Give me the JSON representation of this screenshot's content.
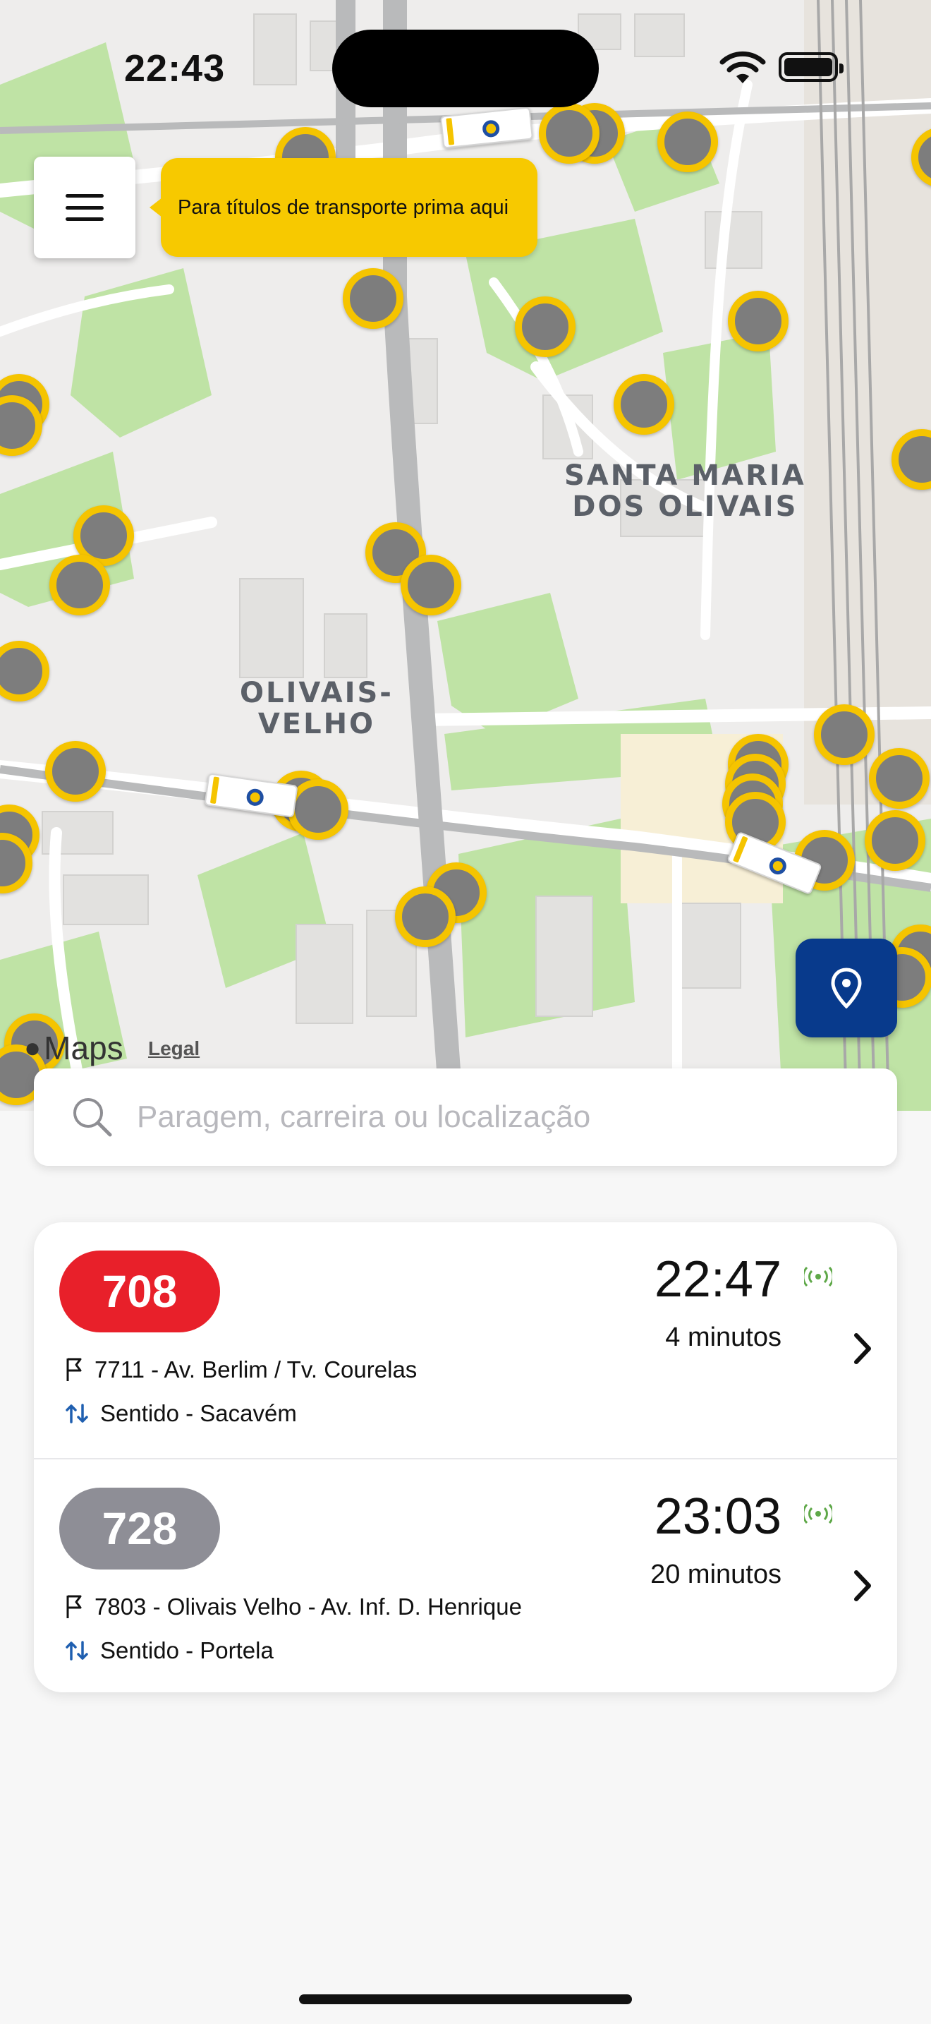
{
  "status_bar": {
    "time": "22:43"
  },
  "map": {
    "tooltip": "Para títulos de transporte prima aqui",
    "districts": [
      "SANTA MARIA\nDOS OLIVAIS",
      "OLIVAIS-\nVELHO"
    ],
    "attribution": {
      "brand": "Maps",
      "legal": "Legal"
    },
    "icons": {
      "menu": "hamburger-menu-icon",
      "locate": "location-pin-icon",
      "stop": "bus-stop-marker",
      "bus": "bus-vehicle-marker"
    }
  },
  "search": {
    "placeholder": "Paragem, carreira ou localização"
  },
  "arrivals": [
    {
      "line": "708",
      "color": "#e8202a",
      "time": "22:47",
      "minutes": "4 minutos",
      "stop": "7711 - Av. Berlim / Tv. Courelas",
      "direction": "Sentido - Sacavém"
    },
    {
      "line": "728",
      "color": "#8e8e96",
      "time": "23:03",
      "minutes": "20 minutos",
      "stop": "7803 - Olivais Velho - Av. Inf. D. Henrique",
      "direction": "Sentido - Portela"
    }
  ],
  "colors": {
    "accent_yellow": "#f7c900",
    "brand_blue": "#083a8c",
    "live_green": "#5fa849"
  }
}
